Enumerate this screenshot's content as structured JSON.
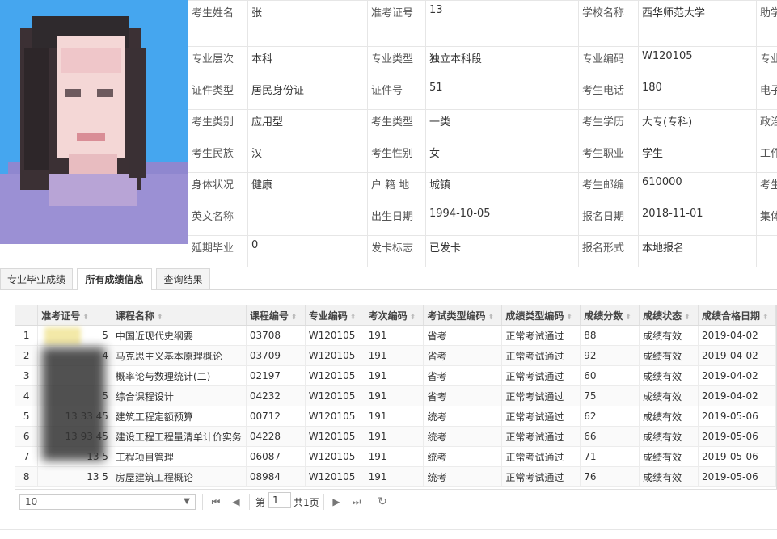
{
  "info": {
    "rows": [
      [
        {
          "l": "考生姓名",
          "v": "张"
        },
        {
          "l": "准考证号",
          "v": "13"
        },
        {
          "l": "学校名称",
          "v": "西华师范大学"
        },
        {
          "l": "助学",
          "v": ""
        }
      ],
      [
        {
          "l": "专业层次",
          "v": "本科"
        },
        {
          "l": "专业类型",
          "v": "独立本科段"
        },
        {
          "l": "专业编码",
          "v": "W120105"
        },
        {
          "l": "专业",
          "v": ""
        }
      ],
      [
        {
          "l": "证件类型",
          "v": "居民身份证"
        },
        {
          "l": "证件号",
          "v": "51"
        },
        {
          "l": "考生电话",
          "v": "180"
        },
        {
          "l": "电子",
          "v": ""
        }
      ],
      [
        {
          "l": "考生类别",
          "v": "应用型"
        },
        {
          "l": "考生类型",
          "v": "一类"
        },
        {
          "l": "考生学历",
          "v": "大专(专科)"
        },
        {
          "l": "政治",
          "v": ""
        }
      ],
      [
        {
          "l": "考生民族",
          "v": "汉"
        },
        {
          "l": "考生性别",
          "v": "女"
        },
        {
          "l": "考生职业",
          "v": "学生"
        },
        {
          "l": "工作",
          "v": ""
        }
      ],
      [
        {
          "l": "身体状况",
          "v": "健康"
        },
        {
          "l": "户 籍 地",
          "v": "城镇"
        },
        {
          "l": "考生邮编",
          "v": "610000"
        },
        {
          "l": "考生",
          "v": ""
        }
      ],
      [
        {
          "l": "英文名称",
          "v": ""
        },
        {
          "l": "出生日期",
          "v": "1994-10-05"
        },
        {
          "l": "报名日期",
          "v": "2018-11-01"
        },
        {
          "l": "集体",
          "v": ""
        }
      ],
      [
        {
          "l": "延期毕业",
          "v": "0"
        },
        {
          "l": "发卡标志",
          "v": "已发卡"
        },
        {
          "l": "报名形式",
          "v": "本地报名"
        },
        {
          "l": "",
          "v": ""
        }
      ]
    ]
  },
  "tabs": [
    "专业毕业成绩",
    "所有成绩信息",
    "查询结果"
  ],
  "grid": {
    "columns": [
      "准考证号",
      "课程名称",
      "课程编号",
      "专业编码",
      "考次编码",
      "考试类型编码",
      "成绩类型编码",
      "成绩分数",
      "成绩状态",
      "成绩合格日期"
    ],
    "rows": [
      [
        "1",
        "5",
        "中国近现代史纲要",
        "03708",
        "W120105",
        "191",
        "省考",
        "正常考试通过",
        "88",
        "成绩有效",
        "2019-04-02"
      ],
      [
        "2",
        "4",
        "马克思主义基本原理概论",
        "03709",
        "W120105",
        "191",
        "省考",
        "正常考试通过",
        "92",
        "成绩有效",
        "2019-04-02"
      ],
      [
        "3",
        "",
        "概率论与数理统计(二)",
        "02197",
        "W120105",
        "191",
        "省考",
        "正常考试通过",
        "60",
        "成绩有效",
        "2019-04-02"
      ],
      [
        "4",
        "5",
        "综合课程设计",
        "04232",
        "W120105",
        "191",
        "省考",
        "正常考试通过",
        "75",
        "成绩有效",
        "2019-04-02"
      ],
      [
        "5",
        "13 33 45",
        "建筑工程定额预算",
        "00712",
        "W120105",
        "191",
        "统考",
        "正常考试通过",
        "62",
        "成绩有效",
        "2019-05-06"
      ],
      [
        "6",
        "13 93 45",
        "建设工程工程量清单计价实务",
        "04228",
        "W120105",
        "191",
        "统考",
        "正常考试通过",
        "66",
        "成绩有效",
        "2019-05-06"
      ],
      [
        "7",
        "13 5",
        "工程项目管理",
        "06087",
        "W120105",
        "191",
        "统考",
        "正常考试通过",
        "71",
        "成绩有效",
        "2019-05-06"
      ],
      [
        "8",
        "13 5",
        "房屋建筑工程概论",
        "08984",
        "W120105",
        "191",
        "统考",
        "正常考试通过",
        "76",
        "成绩有效",
        "2019-05-06"
      ]
    ]
  },
  "pager": {
    "page_size": "10",
    "page_prefix": "第",
    "page_num": "1",
    "page_suffix": "共1页"
  },
  "colors": {
    "photo_bg": "#45a6ef",
    "accent": "#1e88e5"
  }
}
